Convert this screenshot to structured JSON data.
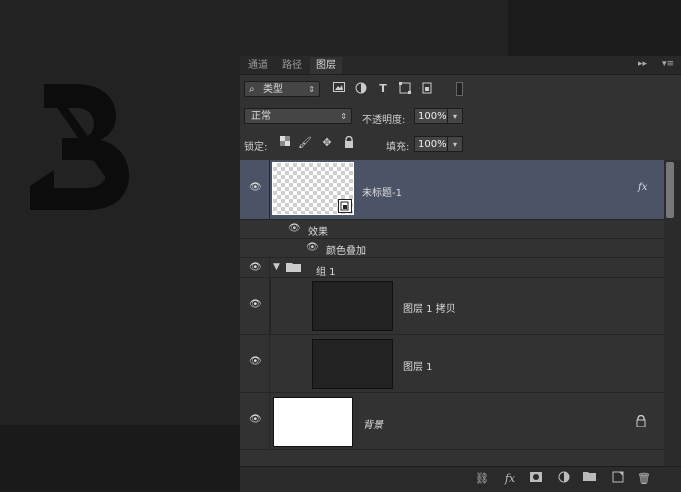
{
  "tabs": [
    {
      "label": "通道"
    },
    {
      "label": "路径"
    },
    {
      "label": "图层"
    }
  ],
  "filter": {
    "label": "类型"
  },
  "blend_mode": {
    "value": "正常"
  },
  "opacity": {
    "label": "不透明度:",
    "value": "100%"
  },
  "lock": {
    "label": "锁定:"
  },
  "fill": {
    "label": "填充:",
    "value": "100%"
  },
  "layers": {
    "top": {
      "name": "未标题-1",
      "fx": "fx"
    },
    "effects_label": "效果",
    "effect_item": "颜色叠加",
    "group": {
      "name": "组 1"
    },
    "layer_copy": {
      "name": "图层 1 拷贝"
    },
    "layer1": {
      "name": "图层 1"
    },
    "background": {
      "name": "背景"
    }
  },
  "bottom_bar": {
    "fx": "fx"
  }
}
